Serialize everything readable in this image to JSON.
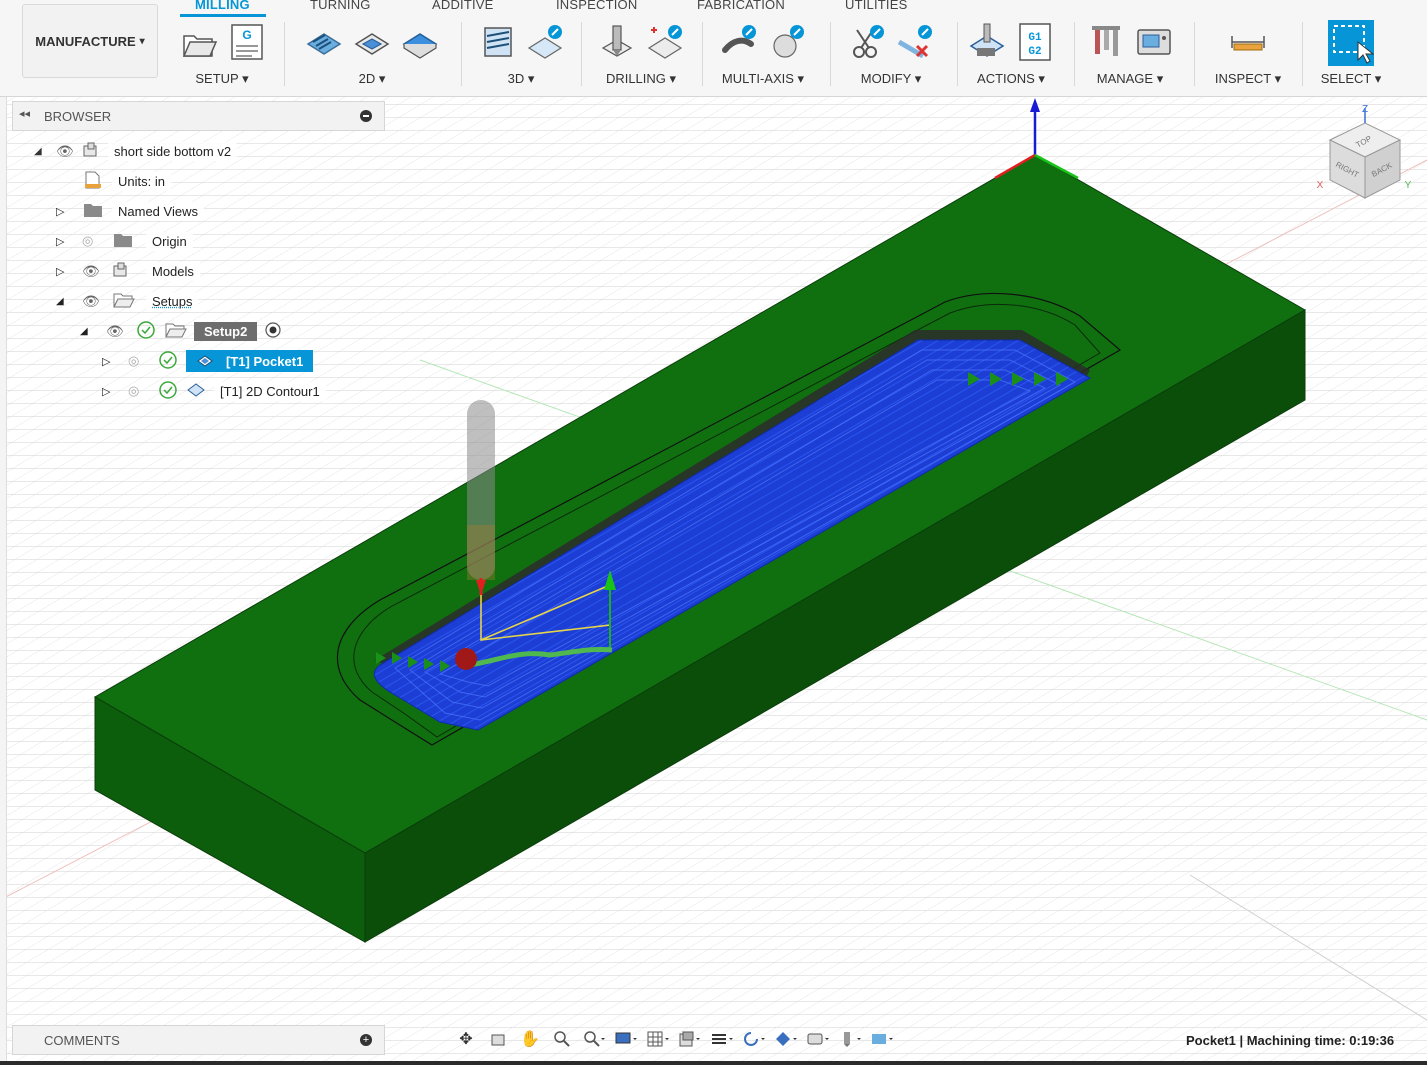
{
  "workspace": {
    "label": "MANUFACTURE",
    "caret": "▾"
  },
  "tabs": [
    {
      "label": "MILLING",
      "active": true
    },
    {
      "label": "TURNING",
      "active": false
    },
    {
      "label": "ADDITIVE",
      "active": false
    },
    {
      "label": "INSPECTION",
      "active": false
    },
    {
      "label": "FABRICATION",
      "active": false
    },
    {
      "label": "UTILITIES",
      "active": false
    }
  ],
  "groups": {
    "setup": "SETUP ▾",
    "two_d": "2D ▾",
    "three_d": "3D ▾",
    "drilling": "DRILLING ▾",
    "multi_axis": "MULTI-AXIS ▾",
    "modify": "MODIFY ▾",
    "actions": "ACTIONS ▾",
    "manage": "MANAGE ▾",
    "inspect": "INSPECT ▾",
    "select": "SELECT ▾"
  },
  "icon_text": {
    "gcode": "G",
    "g1g2": "G1\nG2"
  },
  "browser": {
    "title": "BROWSER",
    "items": {
      "root": "short side bottom v2",
      "units": "Units: in",
      "named_views": "Named Views",
      "origin": "Origin",
      "models": "Models",
      "setups": "Setups",
      "setup2": "Setup2",
      "pocket": "[T1] Pocket1",
      "contour": "[T1] 2D Contour1"
    }
  },
  "comments": {
    "title": "COMMENTS"
  },
  "viewcube": {
    "top": "TOP",
    "right": "RIGHT",
    "back": "BACK",
    "x": "X",
    "y": "Y",
    "z": "Z"
  },
  "status": {
    "text": "Pocket1 | Machining time: 0:19:36"
  },
  "colors": {
    "accent": "#0696d7",
    "stock_top": "#107010",
    "stock_side": "#0a5a0a",
    "toolpath": "#1f3fd6",
    "grid": "#cfcfcf"
  }
}
